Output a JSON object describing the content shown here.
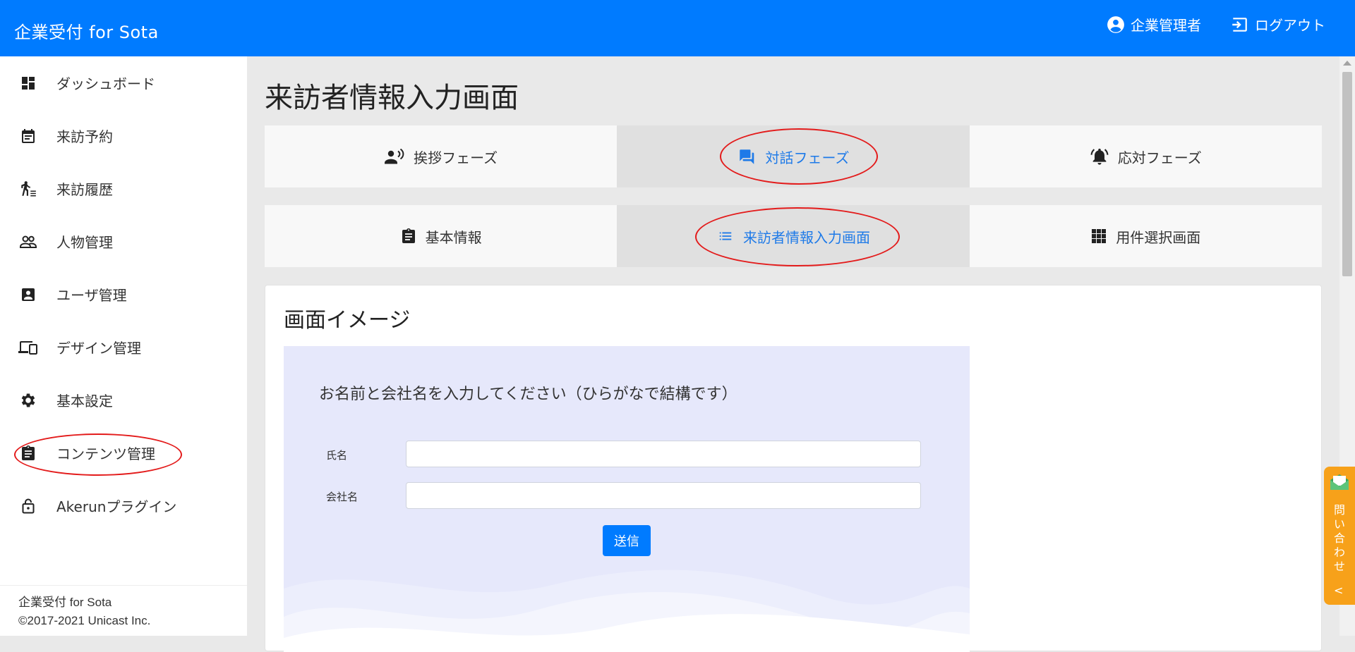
{
  "header": {
    "brand": "企業受付 for Sota",
    "user_label": "企業管理者",
    "logout_label": "ログアウト",
    "accent_color": "#007bff"
  },
  "sidebar": {
    "items": [
      {
        "label": "ダッシュボード",
        "icon": "dashboard-icon"
      },
      {
        "label": "来訪予約",
        "icon": "calendar-icon"
      },
      {
        "label": "来訪履歴",
        "icon": "walking-person-icon"
      },
      {
        "label": "人物管理",
        "icon": "people-icon"
      },
      {
        "label": "ユーザ管理",
        "icon": "account-box-icon"
      },
      {
        "label": "デザイン管理",
        "icon": "devices-icon"
      },
      {
        "label": "基本設定",
        "icon": "gear-icon"
      },
      {
        "label": "コンテンツ管理",
        "icon": "clipboard-icon"
      },
      {
        "label": "Akerunプラグイン",
        "icon": "lock-open-icon"
      }
    ],
    "footer_line1": "企業受付 for Sota",
    "footer_line2": "©2017-2021 Unicast Inc."
  },
  "main": {
    "title": "来訪者情報入力画面",
    "phase_tabs": [
      {
        "label": "挨拶フェーズ",
        "icon": "speaking-person-icon",
        "active": false
      },
      {
        "label": "対話フェーズ",
        "icon": "chat-icon",
        "active": true
      },
      {
        "label": "応対フェーズ",
        "icon": "bell-icon",
        "active": false
      }
    ],
    "screen_tabs": [
      {
        "label": "基本情報",
        "icon": "clipboard-icon",
        "active": false
      },
      {
        "label": "来訪者情報入力画面",
        "icon": "list-icon",
        "active": true
      },
      {
        "label": "用件選択画面",
        "icon": "grid-icon",
        "active": false
      }
    ],
    "card": {
      "title": "画面イメージ",
      "prompt": "お名前と会社名を入力してください（ひらがなで結構です）",
      "name_label": "氏名",
      "name_value": "",
      "company_label": "会社名",
      "company_value": "",
      "submit_label": "送信"
    }
  },
  "contact_tab": {
    "label": "問い合わせ",
    "chevron": "<",
    "color": "#f7a11a"
  }
}
